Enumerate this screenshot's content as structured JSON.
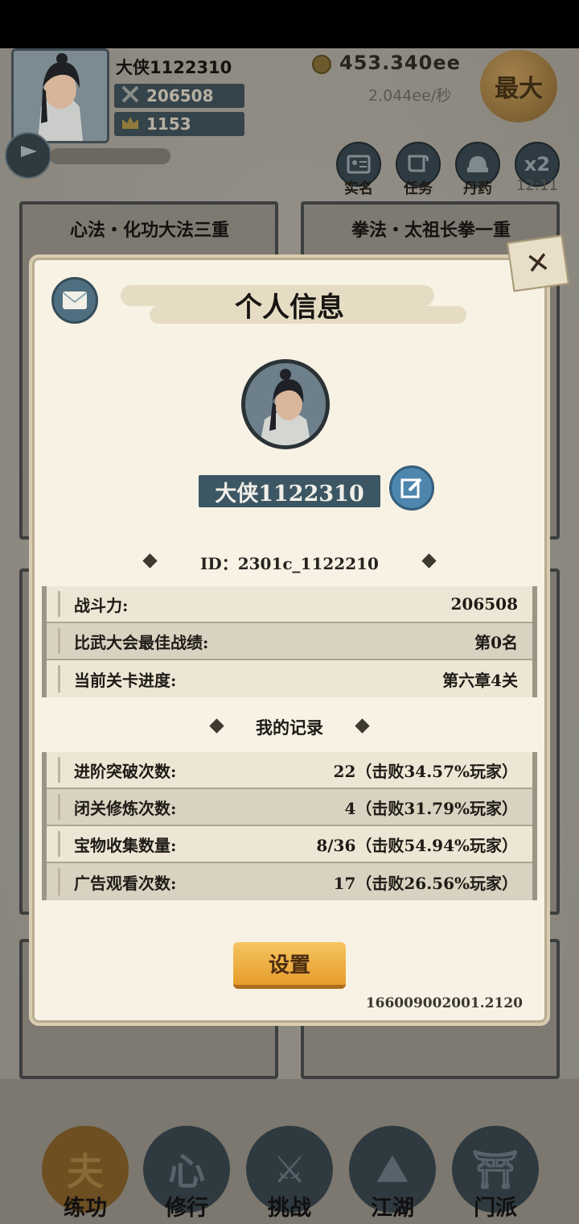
{
  "header": {
    "player_name": "大侠1122310",
    "power": "206508",
    "gold": "1153",
    "currency": "453.340ee",
    "currency_rate": "2.044ee/秒",
    "max_label": "最大",
    "buttons": [
      {
        "label": "实名",
        "icon": "id-card-icon"
      },
      {
        "label": "任务",
        "icon": "scroll-icon"
      },
      {
        "label": "丹药",
        "icon": "pill-icon"
      },
      {
        "label": "12:11",
        "icon": "x2",
        "glyph": "x2"
      }
    ]
  },
  "background_cards": [
    {
      "title": "心法・化功大法三重"
    },
    {
      "title": "拳法・太祖长拳一重"
    }
  ],
  "modal": {
    "title": "个人信息",
    "name": "大侠1122310",
    "id_text": "ID：2301c_1122210",
    "stats": [
      {
        "label": "战斗力:",
        "value": "206508"
      },
      {
        "label": "比武大会最佳战绩:",
        "value": "第0名"
      },
      {
        "label": "当前关卡进度:",
        "value": "第六章4关"
      }
    ],
    "records_title": "我的记录",
    "records": [
      {
        "label": "进阶突破次数:",
        "value": "22（击败34.57%玩家）"
      },
      {
        "label": "闭关修炼次数:",
        "value": "4（击败31.79%玩家）"
      },
      {
        "label": "宝物收集数量:",
        "value": "8/36（击败54.94%玩家）"
      },
      {
        "label": "广告观看次数:",
        "value": "17（击败26.56%玩家）"
      }
    ],
    "settings_label": "设置",
    "version": "166009002001.2120"
  },
  "nav": [
    {
      "label": "练功",
      "glyph": "夫",
      "active": true
    },
    {
      "label": "修行",
      "glyph": "心",
      "active": false
    },
    {
      "label": "挑战",
      "glyph": "⚔",
      "active": false
    },
    {
      "label": "江湖",
      "glyph": "⛰",
      "active": false
    },
    {
      "label": "门派",
      "glyph": "⛩",
      "active": false
    }
  ]
}
